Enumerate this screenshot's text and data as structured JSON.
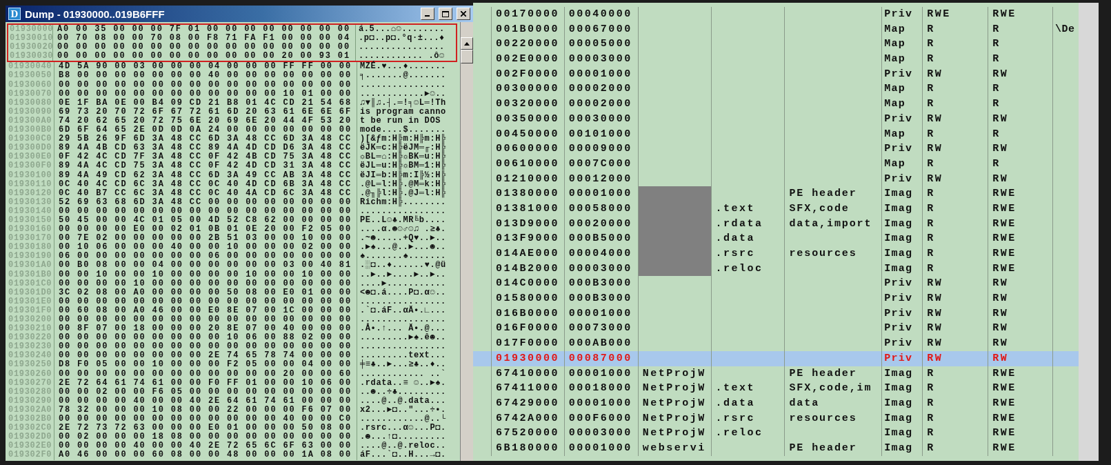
{
  "dump_window": {
    "icon_letter": "D",
    "title": "Dump - 01930000..019B6FFF",
    "rows": [
      {
        "address": "01930000",
        "hex": "A0 00 35 00 00 00 7F 01 00 00 00 00 00 00 00 00",
        "ascii": "á.5...⌂☺........",
        "outlined": true
      },
      {
        "address": "01930010",
        "hex": "00 70 08 00 00 70 08 00 F8 71 FA F1 00 00 00 04",
        "ascii": ".p◘..p◘.°q·±...♦",
        "outlined": true
      },
      {
        "address": "01930020",
        "hex": "00 00 00 00 00 00 00 00 00 00 00 00 00 00 00 00",
        "ascii": "................",
        "outlined": true
      },
      {
        "address": "01930030",
        "hex": "00 00 00 00 00 00 00 00 00 00 00 00 20 00 93 01",
        "ascii": "............ .ô☺",
        "outlined": true
      },
      {
        "address": "01930040",
        "hex": "4D 5A 90 00 03 00 00 00 04 00 00 00 FF FF 00 00",
        "ascii": "MZÉ.♥...♦.......",
        "outlined": false
      },
      {
        "address": "01930050",
        "hex": "B8 00 00 00 00 00 00 00 40 00 00 00 00 00 00 00",
        "ascii": "╕.......@.......",
        "outlined": false
      },
      {
        "address": "01930060",
        "hex": "00 00 00 00 00 00 00 00 00 00 00 00 00 00 00 00",
        "ascii": "................",
        "outlined": false
      },
      {
        "address": "01930070",
        "hex": "00 00 00 00 00 00 00 00 00 00 00 00 10 01 00 00",
        "ascii": "............►☺..",
        "outlined": false
      },
      {
        "address": "01930080",
        "hex": "0E 1F BA 0E 00 B4 09 CD 21 B8 01 4C CD 21 54 68",
        "ascii": "♫▼║♫.┤.═!╕☺L═!Th",
        "outlined": false
      },
      {
        "address": "01930090",
        "hex": "69 73 20 70 72 6F 67 72 61 6D 20 63 61 6E 6E 6F",
        "ascii": "is program canno",
        "outlined": false
      },
      {
        "address": "019300A0",
        "hex": "74 20 62 65 20 72 75 6E 20 69 6E 20 44 4F 53 20",
        "ascii": "t be run in DOS ",
        "outlined": false
      },
      {
        "address": "019300B0",
        "hex": "6D 6F 64 65 2E 0D 0D 0A 24 00 00 00 00 00 00 00",
        "ascii": "mode....$.......",
        "outlined": false
      },
      {
        "address": "019300C0",
        "hex": "29 5B 26 9F 6D 3A 48 CC 6D 3A 48 CC 6D 3A 48 CC",
        "ascii": ")[&ƒm:H╠m:H╠m:H╠",
        "outlined": false
      },
      {
        "address": "019300D0",
        "hex": "89 4A 4B CD 63 3A 48 CC 89 4A 4D CD D6 3A 48 CC",
        "ascii": "ëJK═c:H╠ëJM═╓:H╠",
        "outlined": false
      },
      {
        "address": "019300E0",
        "hex": "0F 42 4C CD 7F 3A 48 CC 0F 42 4B CD 75 3A 48 CC",
        "ascii": "☼BL═⌂:H╠☼BK═u:H╠",
        "outlined": false
      },
      {
        "address": "019300F0",
        "hex": "89 4A 4C CD 75 3A 48 CC 0F 42 4D CD 31 3A 48 CC",
        "ascii": "ëJL═u:H╠☼BM═1:H╠",
        "outlined": false
      },
      {
        "address": "01930100",
        "hex": "89 4A 49 CD 62 3A 48 CC 6D 3A 49 CC AB 3A 48 CC",
        "ascii": "ëJI═b:H╠m:I╠½:H╠",
        "outlined": false
      },
      {
        "address": "01930110",
        "hex": "0C 40 4C CD 6C 3A 48 CC 0C 40 4D CD 6B 3A 48 CC",
        "ascii": ".@L═l:H╠.@M═k:H╠",
        "outlined": false
      },
      {
        "address": "01930120",
        "hex": "0C 40 B7 CC 6C 3A 48 CC 0C 40 4A CD 6C 3A 48 CC",
        "ascii": ".@╖╠l:H╠.@J═l:H╠",
        "outlined": false
      },
      {
        "address": "01930130",
        "hex": "52 69 63 68 6D 3A 48 CC 00 00 00 00 00 00 00 00",
        "ascii": "Richm:H╠........",
        "outlined": false
      },
      {
        "address": "01930140",
        "hex": "00 00 00 00 00 00 00 00 00 00 00 00 00 00 00 00",
        "ascii": "................",
        "outlined": false
      },
      {
        "address": "01930150",
        "hex": "50 45 00 00 4C 01 05 00 4D 52 C8 62 00 00 00 00",
        "ascii": "PE..L☺♣.MR╚b....",
        "outlined": false
      },
      {
        "address": "01930160",
        "hex": "00 00 00 00 E0 00 02 01 0B 01 0E 20 00 F2 05 00",
        "ascii": "....α.☻☺♂☺♫ .≥♣.",
        "outlined": false
      },
      {
        "address": "01930170",
        "hex": "00 7E 02 00 00 00 00 00 2B 51 03 00 00 10 00 00",
        "ascii": ".~☻.....+Q♥..►..",
        "outlined": false
      },
      {
        "address": "01930180",
        "hex": "00 10 06 00 00 00 40 00 00 10 00 00 00 02 00 00",
        "ascii": ".►♠...@..►...☻..",
        "outlined": false
      },
      {
        "address": "01930190",
        "hex": "06 00 00 00 00 00 00 00 06 00 00 00 00 00 00 00",
        "ascii": "♠.......♠.......",
        "outlined": false
      },
      {
        "address": "019301A0",
        "hex": "00 B0 08 00 00 04 00 00 00 00 00 00 03 00 40 81",
        "ascii": ".░◘..♦......♥.@ü",
        "outlined": false
      },
      {
        "address": "019301B0",
        "hex": "00 00 10 00 00 10 00 00 00 00 10 00 00 10 00 00",
        "ascii": "..►..►....►..►..",
        "outlined": false
      },
      {
        "address": "019301C0",
        "hex": "00 00 00 00 10 00 00 00 00 00 00 00 00 00 00 00",
        "ascii": "....►...........",
        "outlined": false
      },
      {
        "address": "019301D0",
        "hex": "3C 02 08 00 A0 00 00 00 00 50 08 00 E0 01 00 00",
        "ascii": "<☻◘.á....P◘.α☺..",
        "outlined": false
      },
      {
        "address": "019301E0",
        "hex": "00 00 00 00 00 00 00 00 00 00 00 00 00 00 00 00",
        "ascii": "................",
        "outlined": false
      },
      {
        "address": "019301F0",
        "hex": "00 60 08 00 A0 46 00 00 E0 8E 07 00 1C 00 00 00",
        "ascii": ".`◘.áF..αÄ•.∟...",
        "outlined": false
      },
      {
        "address": "01930200",
        "hex": "00 00 00 00 00 00 00 00 00 00 00 00 00 00 00 00",
        "ascii": "................",
        "outlined": false
      },
      {
        "address": "01930210",
        "hex": "00 8F 07 00 18 00 00 00 20 8E 07 00 40 00 00 00",
        "ascii": ".Å•.↑... Ä•.@...",
        "outlined": false
      },
      {
        "address": "01930220",
        "hex": "00 00 00 00 00 00 00 00 00 10 06 00 88 02 00 00",
        "ascii": ".........►♠.ê☻..",
        "outlined": false
      },
      {
        "address": "01930230",
        "hex": "00 00 00 00 00 00 00 00 00 00 00 00 00 00 00 00",
        "ascii": "................",
        "outlined": false
      },
      {
        "address": "01930240",
        "hex": "00 00 00 00 00 00 00 00 2E 74 65 78 74 00 00 00",
        "ascii": ".........text...",
        "outlined": false
      },
      {
        "address": "01930250",
        "hex": "D8 F0 05 00 00 10 00 00 00 F2 05 00 00 04 00 00",
        "ascii": "╪≡♣..►...≥♣..♦..",
        "outlined": false
      },
      {
        "address": "01930260",
        "hex": "00 00 00 00 00 00 00 00 00 00 00 00 20 00 00 60",
        "ascii": "............ ..`",
        "outlined": false
      },
      {
        "address": "01930270",
        "hex": "2E 72 64 61 74 61 00 00 F0 FF 01 00 00 10 06 00",
        "ascii": ".rdata..≡ ☺..►♠.",
        "outlined": false
      },
      {
        "address": "01930280",
        "hex": "00 00 02 00 00 F6 05 00 00 00 00 00 00 00 00 00",
        "ascii": "..☻..÷♣.........",
        "outlined": false
      },
      {
        "address": "01930290",
        "hex": "00 00 00 00 40 00 00 40 2E 64 61 74 61 00 00 00",
        "ascii": "....@..@.data...",
        "outlined": false
      },
      {
        "address": "019302A0",
        "hex": "78 32 00 00 00 10 08 00 00 22 00 00 00 F6 07 00",
        "ascii": "x2...►◘..\"...÷•.",
        "outlined": false
      },
      {
        "address": "019302B0",
        "hex": "00 00 00 00 00 00 00 00 00 00 00 00 40 00 00 C0",
        "ascii": "............@..└",
        "outlined": false
      },
      {
        "address": "019302C0",
        "hex": "2E 72 73 72 63 00 00 00 E0 01 00 00 00 50 08 00",
        "ascii": ".rsrc...α☺...P◘.",
        "outlined": false
      },
      {
        "address": "019302D0",
        "hex": "00 02 00 00 00 18 08 00 00 00 00 00 00 00 00 00",
        "ascii": ".☻...↑◘.........",
        "outlined": false
      },
      {
        "address": "019302E0",
        "hex": "00 00 00 00 40 00 00 40 2E 72 65 6C 6F 63 00 00",
        "ascii": "....@..@.reloc..",
        "outlined": false
      },
      {
        "address": "019302F0",
        "hex": "A0 46 00 00 00 60 08 00 00 48 00 00 00 1A 08 00",
        "ascii": "áF...`◘..H...→◘.",
        "outlined": false
      }
    ]
  },
  "memory_map": {
    "rows": [
      {
        "address": "00170000",
        "size": "00040000",
        "type": "Priv",
        "access": "RWE",
        "initial": "RWE",
        "owner_redacted": false,
        "selected": false
      },
      {
        "address": "001B0000",
        "size": "00067000",
        "type": "Map",
        "access": "R",
        "initial": "R",
        "mapped": "\\De",
        "owner_redacted": false,
        "selected": false
      },
      {
        "address": "00220000",
        "size": "00005000",
        "type": "Map",
        "access": "R",
        "initial": "R",
        "owner_redacted": false,
        "selected": false
      },
      {
        "address": "002E0000",
        "size": "00003000",
        "type": "Map",
        "access": "R",
        "initial": "R",
        "owner_redacted": false,
        "selected": false
      },
      {
        "address": "002F0000",
        "size": "00001000",
        "type": "Priv",
        "access": "RW",
        "initial": "RW",
        "owner_redacted": false,
        "selected": false
      },
      {
        "address": "00300000",
        "size": "00002000",
        "type": "Map",
        "access": "R",
        "initial": "R",
        "owner_redacted": false,
        "selected": false
      },
      {
        "address": "00320000",
        "size": "00002000",
        "type": "Map",
        "access": "R",
        "initial": "R",
        "owner_redacted": false,
        "selected": false
      },
      {
        "address": "00350000",
        "size": "00030000",
        "type": "Priv",
        "access": "RW",
        "initial": "RW",
        "owner_redacted": false,
        "selected": false
      },
      {
        "address": "00450000",
        "size": "00101000",
        "type": "Map",
        "access": "R",
        "initial": "R",
        "owner_redacted": false,
        "selected": false
      },
      {
        "address": "00600000",
        "size": "00009000",
        "type": "Priv",
        "access": "RW",
        "initial": "RW",
        "owner_redacted": false,
        "selected": false
      },
      {
        "address": "00610000",
        "size": "0007C000",
        "type": "Map",
        "access": "R",
        "initial": "R",
        "owner_redacted": false,
        "selected": false
      },
      {
        "address": "01210000",
        "size": "00012000",
        "type": "Priv",
        "access": "RW",
        "initial": "RW",
        "owner_redacted": false,
        "selected": false
      },
      {
        "address": "01380000",
        "size": "00001000",
        "contains": "PE header",
        "type": "Imag",
        "access": "R",
        "initial": "RWE",
        "owner_redacted": true,
        "selected": false
      },
      {
        "address": "01381000",
        "size": "00058000",
        "section": ".text",
        "contains": "SFX,code",
        "type": "Imag",
        "access": "R",
        "initial": "RWE",
        "owner_redacted": true,
        "selected": false
      },
      {
        "address": "013D9000",
        "size": "00020000",
        "section": ".rdata",
        "contains": "data,import",
        "type": "Imag",
        "access": "R",
        "initial": "RWE",
        "owner_redacted": true,
        "selected": false
      },
      {
        "address": "013F9000",
        "size": "000B5000",
        "section": ".data",
        "type": "Imag",
        "access": "R",
        "initial": "RWE",
        "owner_redacted": true,
        "selected": false
      },
      {
        "address": "014AE000",
        "size": "00004000",
        "section": ".rsrc",
        "contains": "resources",
        "type": "Imag",
        "access": "R",
        "initial": "RWE",
        "owner_redacted": true,
        "selected": false
      },
      {
        "address": "014B2000",
        "size": "00003000",
        "section": ".reloc",
        "type": "Imag",
        "access": "R",
        "initial": "RWE",
        "owner_redacted": true,
        "selected": false
      },
      {
        "address": "014C0000",
        "size": "000B3000",
        "type": "Priv",
        "access": "RW",
        "initial": "RW",
        "owner_redacted": false,
        "selected": false
      },
      {
        "address": "01580000",
        "size": "000B3000",
        "type": "Priv",
        "access": "RW",
        "initial": "RW",
        "owner_redacted": false,
        "selected": false
      },
      {
        "address": "016B0000",
        "size": "00001000",
        "type": "Priv",
        "access": "RW",
        "initial": "RW",
        "owner_redacted": false,
        "selected": false
      },
      {
        "address": "016F0000",
        "size": "00073000",
        "type": "Priv",
        "access": "RW",
        "initial": "RW",
        "owner_redacted": false,
        "selected": false
      },
      {
        "address": "017F0000",
        "size": "000AB000",
        "type": "Priv",
        "access": "RW",
        "initial": "RW",
        "owner_redacted": false,
        "selected": false
      },
      {
        "address": "01930000",
        "size": "00087000",
        "type": "Priv",
        "access": "RW",
        "initial": "RW",
        "owner_redacted": false,
        "selected": true
      },
      {
        "address": "67410000",
        "size": "00001000",
        "owner": "NetProjW",
        "contains": "PE header",
        "type": "Imag",
        "access": "R",
        "initial": "RWE",
        "owner_redacted": false,
        "selected": false
      },
      {
        "address": "67411000",
        "size": "00018000",
        "owner": "NetProjW",
        "section": ".text",
        "contains": "SFX,code,im",
        "type": "Imag",
        "access": "R",
        "initial": "RWE",
        "owner_redacted": false,
        "selected": false
      },
      {
        "address": "67429000",
        "size": "00001000",
        "owner": "NetProjW",
        "section": ".data",
        "contains": "data",
        "type": "Imag",
        "access": "R",
        "initial": "RWE",
        "owner_redacted": false,
        "selected": false
      },
      {
        "address": "6742A000",
        "size": "000F6000",
        "owner": "NetProjW",
        "section": ".rsrc",
        "contains": "resources",
        "type": "Imag",
        "access": "R",
        "initial": "RWE",
        "owner_redacted": false,
        "selected": false
      },
      {
        "address": "67520000",
        "size": "00003000",
        "owner": "NetProjW",
        "section": ".reloc",
        "type": "Imag",
        "access": "R",
        "initial": "RWE",
        "owner_redacted": false,
        "selected": false
      },
      {
        "address": "6B180000",
        "size": "00001000",
        "owner": "webservi",
        "contains": "PE header",
        "type": "Imag",
        "access": "R",
        "initial": "RWE",
        "owner_redacted": false,
        "selected": false
      }
    ]
  }
}
